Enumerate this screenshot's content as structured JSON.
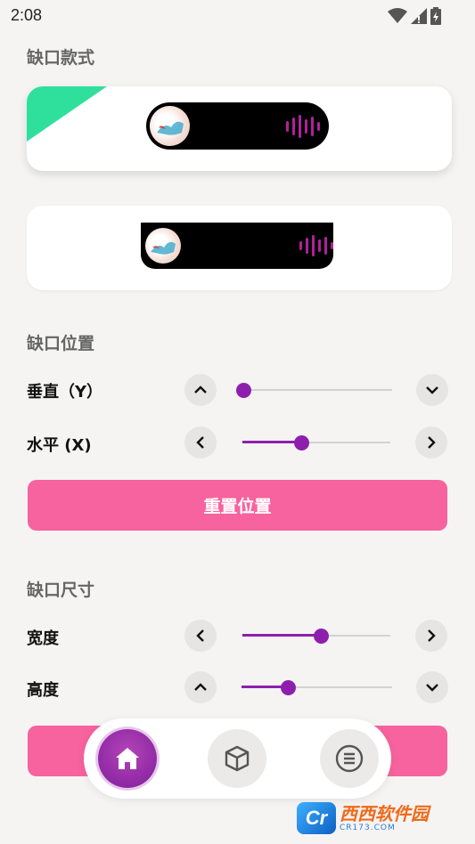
{
  "status_bar": {
    "time": "2:08"
  },
  "sections": {
    "notch_style": "缺口款式",
    "notch_position": "缺口位置",
    "notch_size": "缺口尺寸"
  },
  "position": {
    "vertical_label": "垂直（Y）",
    "vertical_value": 0.02,
    "horizontal_label": "水平 (X)",
    "horizontal_value": 0.4,
    "reset_button": "重置位置"
  },
  "size": {
    "width_label": "宽度",
    "width_value": 0.53,
    "height_label": "高度",
    "height_value": 0.31
  },
  "colors": {
    "accent": "#8e1fad",
    "button": "#f7639e",
    "selected_marker": "#2fe09c"
  },
  "nav": {
    "items": [
      {
        "icon": "home-icon",
        "active": true
      },
      {
        "icon": "cube-icon",
        "active": false
      },
      {
        "icon": "menu-list-icon",
        "active": false
      }
    ]
  },
  "watermark": {
    "logo": "Cr",
    "title": "西西软件园",
    "subtitle": "CR173.COM"
  }
}
